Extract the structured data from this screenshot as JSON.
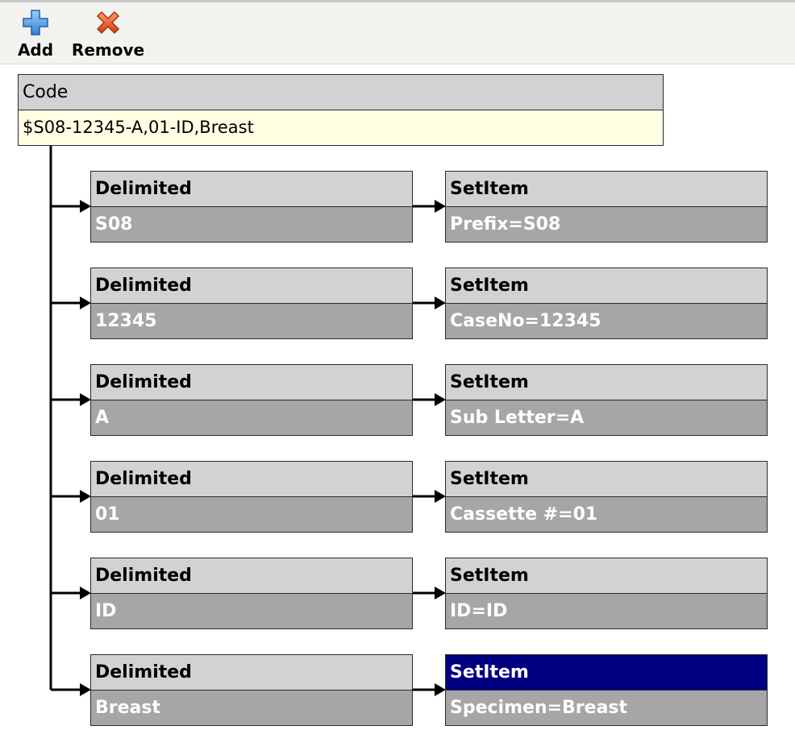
{
  "toolbar": {
    "add_label": "Add",
    "add_icon": "plus-icon",
    "remove_label": "Remove",
    "remove_icon": "x-icon"
  },
  "code_node": {
    "header": "Code",
    "value": "$S08-12345-A,01-ID,Breast"
  },
  "rows": [
    {
      "delimited": {
        "header": "Delimited",
        "value": "S08"
      },
      "setitem": {
        "header": "SetItem",
        "value": "Prefix=S08"
      }
    },
    {
      "delimited": {
        "header": "Delimited",
        "value": "12345"
      },
      "setitem": {
        "header": "SetItem",
        "value": "CaseNo=12345"
      }
    },
    {
      "delimited": {
        "header": "Delimited",
        "value": "A"
      },
      "setitem": {
        "header": "SetItem",
        "value": "Sub Letter=A"
      }
    },
    {
      "delimited": {
        "header": "Delimited",
        "value": "01"
      },
      "setitem": {
        "header": "SetItem",
        "value": "Cassette #=01"
      }
    },
    {
      "delimited": {
        "header": "Delimited",
        "value": "ID"
      },
      "setitem": {
        "header": "SetItem",
        "value": "ID=ID"
      }
    },
    {
      "delimited": {
        "header": "Delimited",
        "value": "Breast"
      },
      "setitem": {
        "header": "SetItem",
        "value": "Specimen=Breast",
        "selected": true
      }
    }
  ],
  "colors": {
    "selected_header": "#000080",
    "header_gray": "#d2d2d2",
    "value_gray": "#a6a6a6",
    "code_value_bg": "#fffee3",
    "add_icon_blue": "#4a90d9",
    "remove_icon_orange": "#e8501e"
  }
}
